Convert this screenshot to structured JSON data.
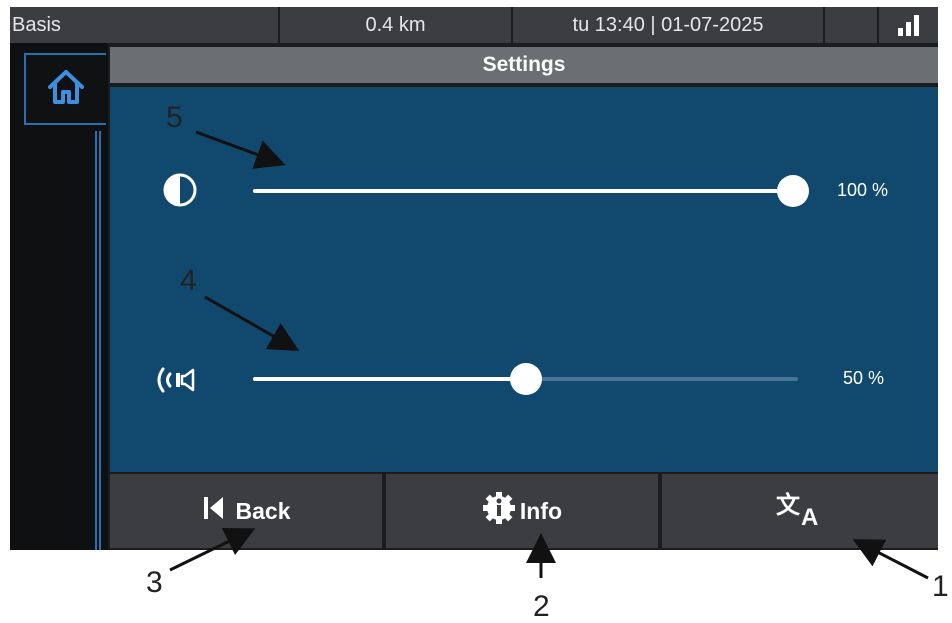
{
  "statusbar": {
    "profile": "Basis",
    "distance": "0.4 km",
    "datetime": "tu 13:40 | 01-07-2025",
    "signal_icon": "signal-bars-icon"
  },
  "nav": {
    "home_icon": "home-icon"
  },
  "title": "Settings",
  "sliders": {
    "brightness": {
      "icon": "contrast-icon",
      "value": 100,
      "value_label": "100 %"
    },
    "volume": {
      "icon": "speaker-icon",
      "value": 50,
      "value_label": "50 %"
    }
  },
  "footer": {
    "back": {
      "label": "Back",
      "icon": "skip-back-icon"
    },
    "info": {
      "label": "Info",
      "icon": "info-gear-icon"
    },
    "language": {
      "label": "",
      "icon": "translate-icon"
    }
  },
  "callouts": [
    "5",
    "4",
    "3",
    "2",
    "1"
  ],
  "colors": {
    "panel": "#11496e",
    "accent": "#2a6fb0",
    "bar": "#3b3d40",
    "title_bar": "#6b6e72"
  }
}
